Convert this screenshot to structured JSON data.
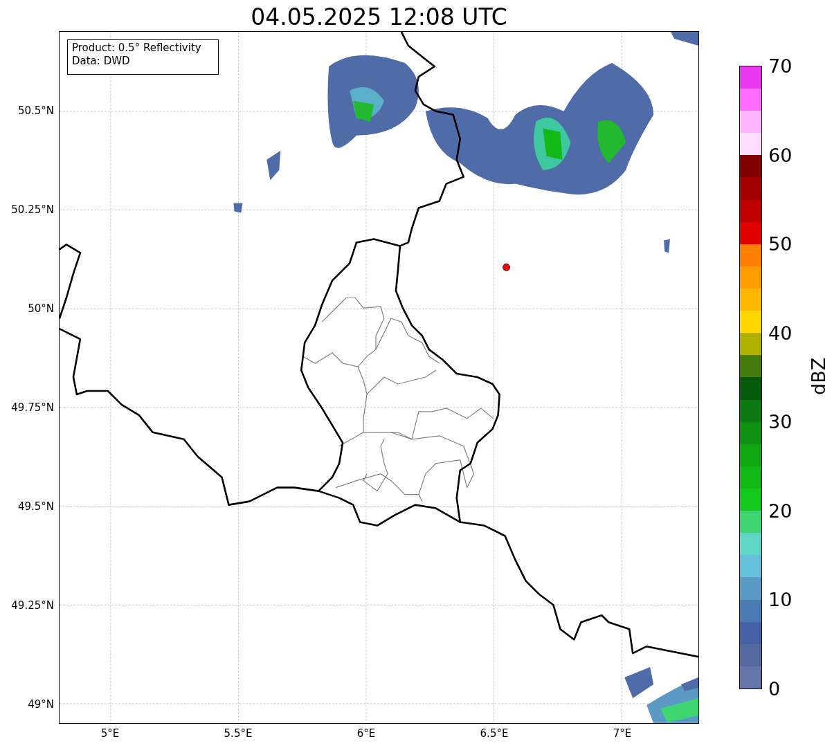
{
  "title": "04.05.2025 12:08 UTC",
  "legend_box": {
    "lines": [
      "Product: 0.5° Reflectivity",
      "Data: DWD"
    ]
  },
  "x_axis": {
    "ticks": [
      "5°E",
      "5.5°E",
      "6°E",
      "6.5°E",
      "7°E"
    ]
  },
  "y_axis": {
    "ticks": [
      "50.5°N",
      "50.25°N",
      "50°N",
      "49.75°N",
      "49.5°N",
      "49.25°N",
      "49°N"
    ]
  },
  "colorbar": {
    "label": "dBZ",
    "ticks": [
      "70",
      "60",
      "50",
      "40",
      "30",
      "20",
      "10",
      "0"
    ],
    "segments": [
      {
        "color": "#6577a8"
      },
      {
        "color": "#5369a0"
      },
      {
        "color": "#4560a5"
      },
      {
        "color": "#4a7ab2"
      },
      {
        "color": "#5a9ac4"
      },
      {
        "color": "#65c0dc"
      },
      {
        "color": "#60d6c4"
      },
      {
        "color": "#3fd672"
      },
      {
        "color": "#12c81a"
      },
      {
        "color": "#12b816"
      },
      {
        "color": "#10a614"
      },
      {
        "color": "#0e9012"
      },
      {
        "color": "#0c7a10"
      },
      {
        "color": "#065a0c"
      },
      {
        "color": "#457a0c"
      },
      {
        "color": "#b0b000"
      },
      {
        "color": "#ffd800"
      },
      {
        "color": "#ffb800"
      },
      {
        "color": "#ff9c00"
      },
      {
        "color": "#ff8000"
      },
      {
        "color": "#e00000"
      },
      {
        "color": "#c00000"
      },
      {
        "color": "#a00000"
      },
      {
        "color": "#800000"
      },
      {
        "color": "#ffdcff"
      },
      {
        "color": "#ffb4ff"
      },
      {
        "color": "#ff6cff"
      },
      {
        "color": "#e838f0"
      }
    ]
  }
}
